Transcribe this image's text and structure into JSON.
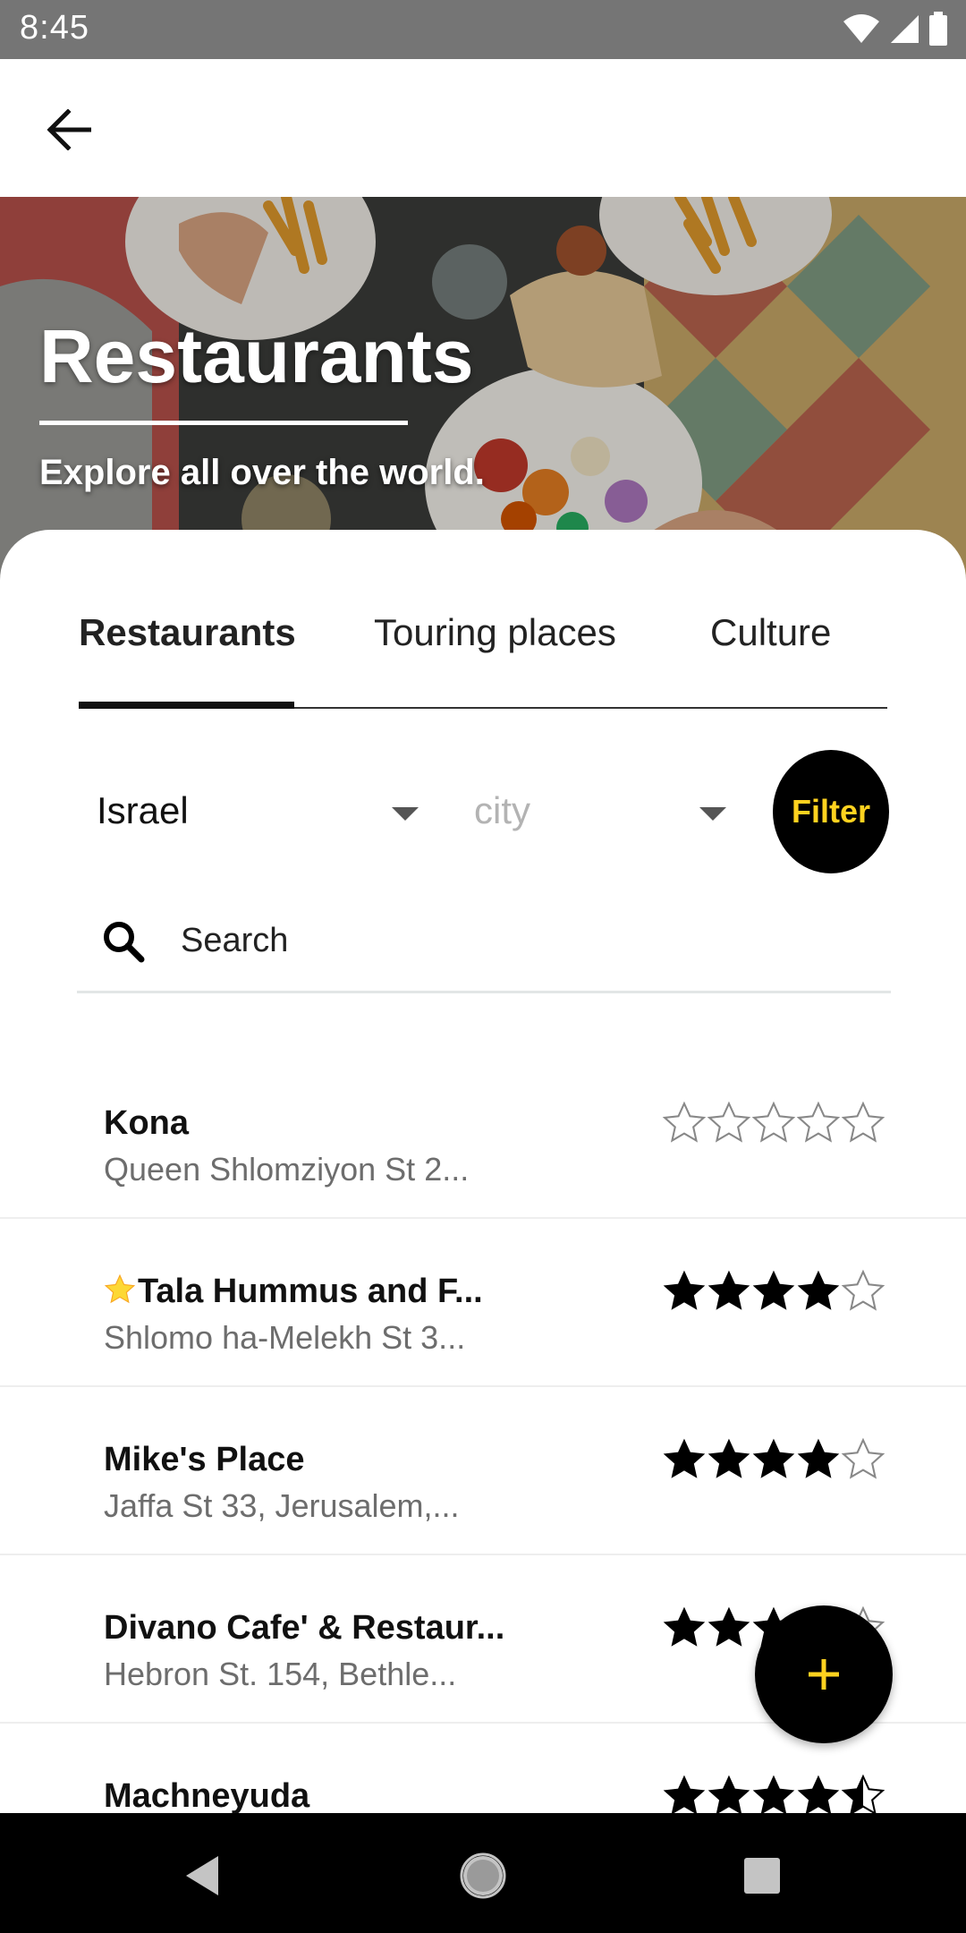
{
  "status_bar": {
    "time": "8:45"
  },
  "hero": {
    "title": "Restaurants",
    "subtitle": "Explore all over the world."
  },
  "tabs": [
    {
      "label": "Restaurants",
      "active": true
    },
    {
      "label": "Touring places",
      "active": false
    },
    {
      "label": "Culture",
      "active": false
    }
  ],
  "filters": {
    "country": {
      "value": "Israel"
    },
    "city": {
      "placeholder": "city"
    },
    "button_label": "Filter"
  },
  "search": {
    "placeholder": "Search"
  },
  "restaurants": [
    {
      "name": "Kona",
      "address": "Queen Shlomziyon St 2...",
      "rating": 0,
      "featured": false
    },
    {
      "name": "Tala Hummus and F...",
      "address": "Shlomo ha-Melekh St 3...",
      "rating": 4,
      "featured": true
    },
    {
      "name": "Mike's Place",
      "address": "Jaffa St 33, Jerusalem,...",
      "rating": 4,
      "featured": false
    },
    {
      "name": "Divano Cafe' & Restaur...",
      "address": "Hebron St. 154, Bethle...",
      "rating": 4,
      "featured": false
    },
    {
      "name": "Machneyuda",
      "address": "",
      "rating": 4.5,
      "featured": false
    }
  ],
  "fab": {
    "icon": "plus-icon"
  },
  "colors": {
    "accent": "#ffd21f",
    "status_bar": "#757575",
    "nav_bar": "#000000"
  }
}
